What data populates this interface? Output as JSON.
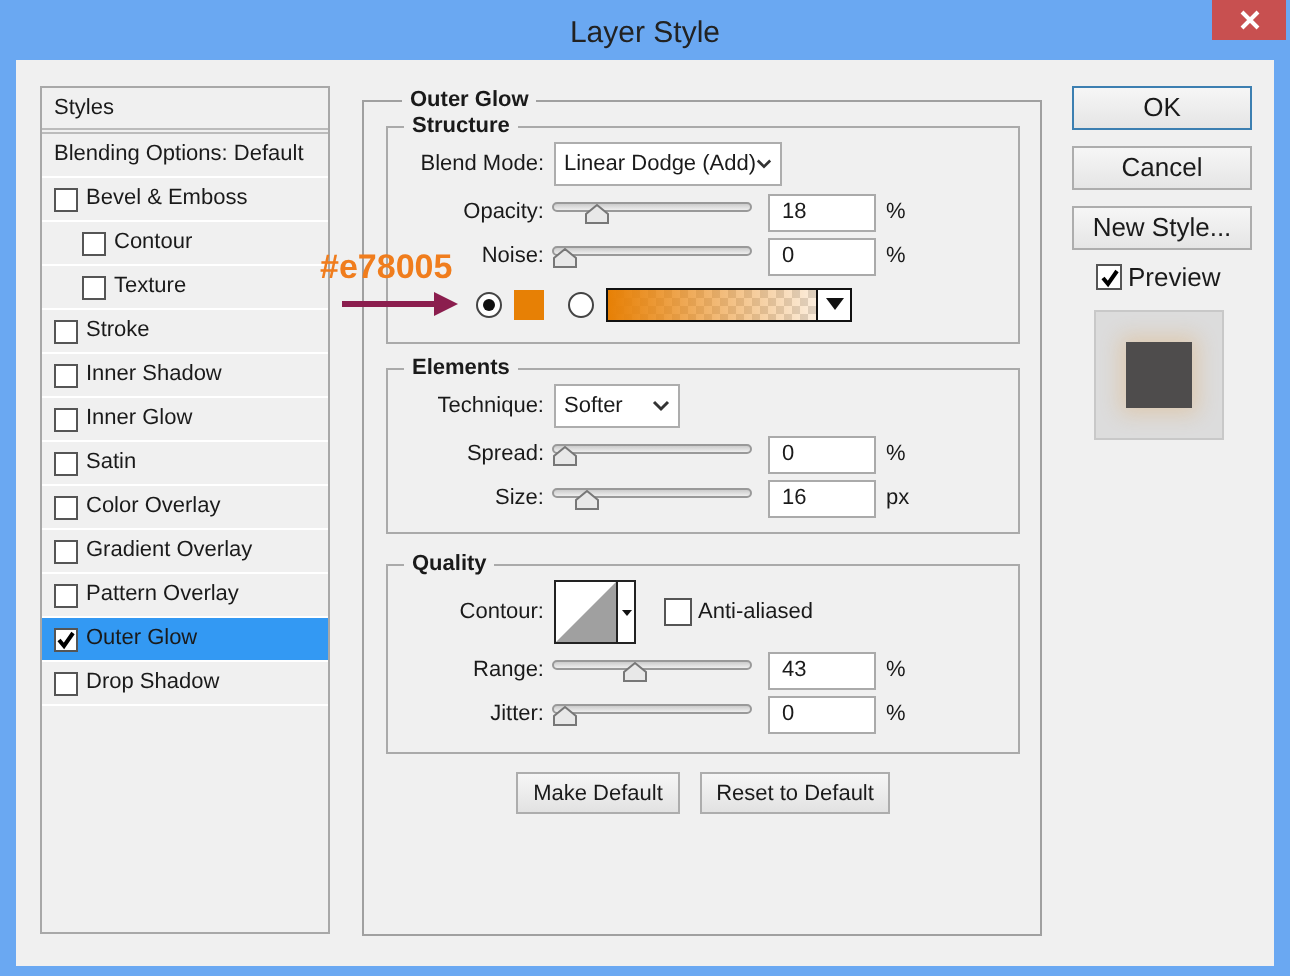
{
  "window": {
    "title": "Layer Style"
  },
  "styles_header": "Styles",
  "styles": [
    {
      "label": "Blending Options: Default",
      "kind": "plain",
      "selected": false
    },
    {
      "label": "Bevel & Emboss",
      "kind": "check",
      "checked": false,
      "selected": false,
      "children": [
        {
          "label": "Contour",
          "kind": "check",
          "checked": false,
          "selected": false
        },
        {
          "label": "Texture",
          "kind": "check",
          "checked": false,
          "selected": false
        }
      ]
    },
    {
      "label": "Stroke",
      "kind": "check",
      "checked": false,
      "selected": false
    },
    {
      "label": "Inner Shadow",
      "kind": "check",
      "checked": false,
      "selected": false
    },
    {
      "label": "Inner Glow",
      "kind": "check",
      "checked": false,
      "selected": false
    },
    {
      "label": "Satin",
      "kind": "check",
      "checked": false,
      "selected": false
    },
    {
      "label": "Color Overlay",
      "kind": "check",
      "checked": false,
      "selected": false
    },
    {
      "label": "Gradient Overlay",
      "kind": "check",
      "checked": false,
      "selected": false
    },
    {
      "label": "Pattern Overlay",
      "kind": "check",
      "checked": false,
      "selected": false
    },
    {
      "label": "Outer Glow",
      "kind": "check",
      "checked": true,
      "selected": true
    },
    {
      "label": "Drop Shadow",
      "kind": "check",
      "checked": false,
      "selected": false
    }
  ],
  "panel_title": "Outer Glow",
  "structure": {
    "title": "Structure",
    "blend_mode": {
      "label": "Blend Mode:",
      "value": "Linear Dodge (Add)"
    },
    "sliders": [
      {
        "label": "Opacity:",
        "level": 0.18,
        "value": "18",
        "unit": "%"
      },
      {
        "label": "Noise:",
        "level": 0,
        "value": "0",
        "unit": "%"
      }
    ],
    "fill_options": [
      {
        "kind": "color",
        "selected": true,
        "color": "#e78005"
      },
      {
        "kind": "gradient",
        "selected": false,
        "color": "#e78005"
      }
    ]
  },
  "elements": {
    "title": "Elements",
    "technique": {
      "label": "Technique:",
      "value": "Softer"
    },
    "sliders": [
      {
        "label": "Spread:",
        "level": 0,
        "value": "0",
        "unit": "%"
      },
      {
        "label": "Size:",
        "level": 0.12,
        "value": "16",
        "unit": "px"
      }
    ]
  },
  "quality": {
    "title": "Quality",
    "contour": {
      "label": "Contour:"
    },
    "anti_aliased": {
      "label": "Anti-aliased",
      "checked": false
    },
    "sliders": [
      {
        "label": "Range:",
        "level": 0.4,
        "value": "43",
        "unit": "%"
      },
      {
        "label": "Jitter:",
        "level": 0,
        "value": "0",
        "unit": "%"
      }
    ]
  },
  "default_buttons": [
    "Make Default",
    "Reset to Default"
  ],
  "actions": [
    "OK",
    "Cancel",
    "New Style..."
  ],
  "preview": {
    "label": "Preview",
    "checked": true
  },
  "annotation": {
    "text": "#e78005"
  }
}
